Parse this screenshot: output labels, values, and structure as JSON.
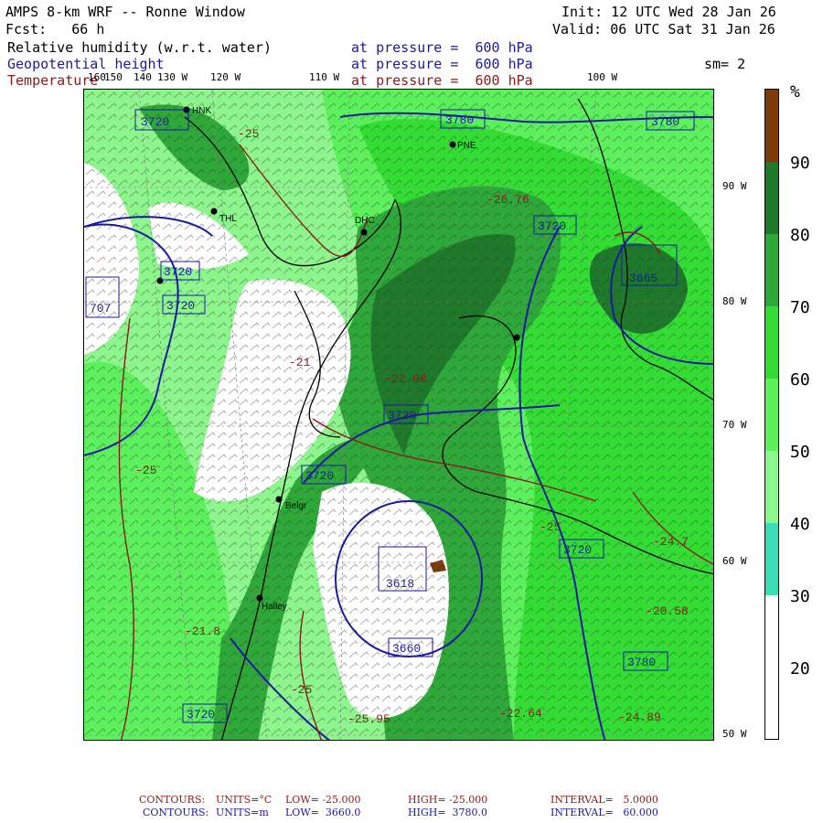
{
  "header": {
    "title": "AMPS 8-km WRF -- Ronne Window",
    "fcst": "Fcst:   66 h",
    "init": "Init: 12 UTC Wed 28 Jan 26",
    "valid": "Valid: 06 UTC Sat 31 Jan 26",
    "rh_label": "Relative humidity (w.r.t. water)",
    "gh_label": "Geopotential height",
    "temp_label": "Temperature",
    "pressure_text": "at pressure =  600 hPa",
    "sm": "sm= 2"
  },
  "lon_labels": [
    "160",
    "150",
    "140",
    "130 W",
    "120 W",
    "110 W",
    "100 W"
  ],
  "lat_labels": [
    "90 W",
    "80 W",
    "70 W",
    "60 W",
    "50 W"
  ],
  "colorbar": {
    "unit": "%",
    "ticks": [
      "90",
      "80",
      "70",
      "60",
      "50",
      "40",
      "30",
      "20"
    ],
    "colors": [
      "#7b3c0a",
      "#1e7a2a",
      "#2fa83a",
      "#33dd33",
      "#5cf05c",
      "#8cf58c",
      "#3cdcb4",
      "#ffffff"
    ]
  },
  "map_labels": {
    "height_boxes": [
      "3720",
      "3780",
      "3720",
      "3665",
      "3720",
      "3720",
      "3720",
      "3618",
      "3660",
      "3720",
      "3780",
      "3720",
      "3720",
      "3780"
    ],
    "low_box_left": "707",
    "temps": [
      "-25",
      "-26.76",
      "-22.08",
      "-21",
      "-25",
      "-25",
      "-24.7",
      "-20.58",
      "-21.8",
      "-25",
      "-25.95",
      "-22.64",
      "-24.89"
    ],
    "stations": [
      "HNK",
      "THL",
      "PNE",
      "DHC",
      "Belgr",
      "Halley"
    ]
  },
  "footer": {
    "line1_label": "CONTOURS:",
    "line1_units": "UNITS=°C",
    "line1_low": "LOW= -25.000",
    "line1_high": "HIGH= -25.000",
    "line1_interval": "INTERVAL=   5.0000",
    "line2_label": "CONTOURS:",
    "line2_units": "UNITS=m",
    "line2_low": "LOW=  3660.0",
    "line2_high": "HIGH=  3780.0",
    "line2_interval": "INTERVAL=   60.000"
  }
}
